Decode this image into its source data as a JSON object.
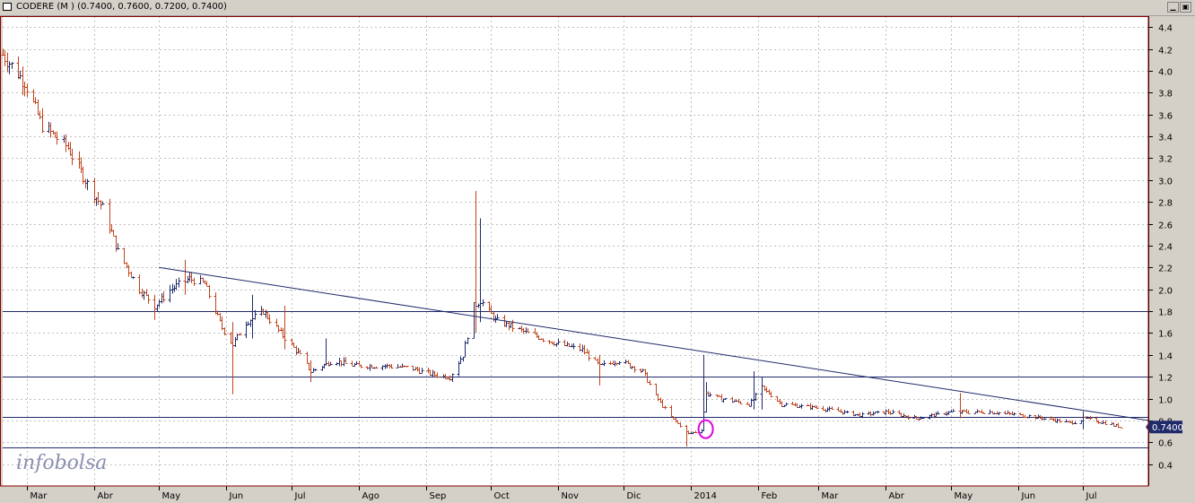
{
  "window": {
    "title": "CODERE (M ) (0.7400, 0.7600, 0.7200, 0.7400)",
    "min_glyph": "▁",
    "max_glyph": "▣"
  },
  "colors": {
    "plot_bg": "#ffffff",
    "grid": "#c0c0c0",
    "up_bar": "#1f2a6b",
    "down_bar": "#c0431c",
    "line": "#1f2a6b",
    "marker": "#e000e0",
    "frame": "#8b0000",
    "price_badge_bg": "#1f2a6b",
    "price_badge_text": "#ffffff"
  },
  "chart_data": {
    "type": "ohlc",
    "title": "CODERE (M ) (0.7400, 0.7600, 0.7200, 0.7400)",
    "ylim": [
      0.2,
      4.5
    ],
    "y_ticks": [
      0.4,
      0.6,
      0.8,
      1.0,
      1.2,
      1.4,
      1.6,
      1.8,
      2.0,
      2.2,
      2.4,
      2.6,
      2.8,
      3.0,
      3.2,
      3.4,
      3.6,
      3.8,
      4.0,
      4.2,
      4.4
    ],
    "y_tick_labels": [
      "0.4",
      "0.6",
      "0.8",
      "1.0",
      "1.2",
      "1.4",
      "1.6",
      "1.8",
      "2.0",
      "2.2",
      "2.4",
      "2.6",
      "2.8",
      "3.0",
      "3.2",
      "3.4",
      "3.6",
      "3.8",
      "4.0",
      "4.2",
      "4.4"
    ],
    "x_start": "2013-02-18",
    "x_end": "2014-07-31",
    "months": [
      {
        "label": "Mar",
        "date": "2013-03-01"
      },
      {
        "label": "Abr",
        "date": "2013-04-01"
      },
      {
        "label": "May",
        "date": "2013-05-01"
      },
      {
        "label": "Jun",
        "date": "2013-06-01"
      },
      {
        "label": "Jul",
        "date": "2013-07-01"
      },
      {
        "label": "Ago",
        "date": "2013-08-01"
      },
      {
        "label": "Sep",
        "date": "2013-09-01"
      },
      {
        "label": "Oct",
        "date": "2013-10-01"
      },
      {
        "label": "Nov",
        "date": "2013-11-01"
      },
      {
        "label": "Dic",
        "date": "2013-12-01"
      },
      {
        "label": "2014",
        "date": "2014-01-01"
      },
      {
        "label": "Feb",
        "date": "2014-02-01"
      },
      {
        "label": "Mar",
        "date": "2014-03-01"
      },
      {
        "label": "Abr",
        "date": "2014-04-01"
      },
      {
        "label": "May",
        "date": "2014-05-01"
      },
      {
        "label": "Jun",
        "date": "2014-06-01"
      },
      {
        "label": "Jul",
        "date": "2014-07-01"
      }
    ],
    "price_anchors": [
      [
        "2013-02-18",
        4.15
      ],
      [
        "2013-02-28",
        3.9
      ],
      [
        "2013-03-08",
        3.5
      ],
      [
        "2013-03-20",
        3.3
      ],
      [
        "2013-03-28",
        3.0
      ],
      [
        "2013-04-05",
        2.75
      ],
      [
        "2013-04-12",
        2.35
      ],
      [
        "2013-04-22",
        2.0
      ],
      [
        "2013-04-29",
        1.85
      ],
      [
        "2013-05-06",
        2.0
      ],
      [
        "2013-05-15",
        2.1
      ],
      [
        "2013-05-22",
        2.05
      ],
      [
        "2013-05-30",
        1.65
      ],
      [
        "2013-06-04",
        1.5
      ],
      [
        "2013-06-10",
        1.7
      ],
      [
        "2013-06-18",
        1.8
      ],
      [
        "2013-06-26",
        1.6
      ],
      [
        "2013-07-05",
        1.4
      ],
      [
        "2013-07-10",
        1.25
      ],
      [
        "2013-07-20",
        1.35
      ],
      [
        "2013-08-01",
        1.3
      ],
      [
        "2013-08-15",
        1.3
      ],
      [
        "2013-08-25",
        1.28
      ],
      [
        "2013-09-05",
        1.22
      ],
      [
        "2013-09-12",
        1.2
      ],
      [
        "2013-09-18",
        1.4
      ],
      [
        "2013-09-23",
        1.85
      ],
      [
        "2013-09-26",
        1.9
      ],
      [
        "2013-10-03",
        1.72
      ],
      [
        "2013-10-18",
        1.6
      ],
      [
        "2013-11-01",
        1.5
      ],
      [
        "2013-11-12",
        1.45
      ],
      [
        "2013-11-20",
        1.3
      ],
      [
        "2013-11-29",
        1.35
      ],
      [
        "2013-12-10",
        1.25
      ],
      [
        "2013-12-15",
        1.05
      ],
      [
        "2013-12-22",
        0.85
      ],
      [
        "2013-12-31",
        0.68
      ],
      [
        "2014-01-06",
        0.72
      ],
      [
        "2014-01-08",
        1.05
      ],
      [
        "2014-01-15",
        1.0
      ],
      [
        "2014-01-28",
        0.95
      ],
      [
        "2014-02-03",
        1.1
      ],
      [
        "2014-02-12",
        0.95
      ],
      [
        "2014-02-28",
        0.92
      ],
      [
        "2014-03-20",
        0.85
      ],
      [
        "2014-04-01",
        0.88
      ],
      [
        "2014-04-15",
        0.82
      ],
      [
        "2014-05-01",
        0.88
      ],
      [
        "2014-05-20",
        0.88
      ],
      [
        "2014-06-10",
        0.83
      ],
      [
        "2014-06-25",
        0.78
      ],
      [
        "2014-07-02",
        0.82
      ],
      [
        "2014-07-15",
        0.76
      ],
      [
        "2014-07-18",
        0.74
      ]
    ],
    "spikes": [
      {
        "date": "2013-04-29",
        "high": 1.95,
        "low": 1.72
      },
      {
        "date": "2013-05-13",
        "high": 2.27,
        "low": 1.95
      },
      {
        "date": "2013-06-04",
        "high": 1.7,
        "low": 1.04
      },
      {
        "date": "2013-06-13",
        "high": 1.95,
        "low": 1.55
      },
      {
        "date": "2013-06-28",
        "high": 1.85,
        "low": 1.45
      },
      {
        "date": "2013-07-10",
        "high": 1.35,
        "low": 1.15
      },
      {
        "date": "2013-07-17",
        "high": 1.55,
        "low": 1.3
      },
      {
        "date": "2013-09-24",
        "high": 2.9,
        "low": 1.6
      },
      {
        "date": "2013-09-26",
        "high": 2.65,
        "low": 1.7
      },
      {
        "date": "2013-09-29",
        "high": 2.1,
        "low": 1.65
      },
      {
        "date": "2013-11-20",
        "high": 1.4,
        "low": 1.12
      },
      {
        "date": "2013-12-30",
        "high": 0.75,
        "low": 0.56
      },
      {
        "date": "2014-01-07",
        "high": 1.4,
        "low": 0.78
      },
      {
        "date": "2014-01-08",
        "high": 1.15,
        "low": 0.9
      },
      {
        "date": "2014-01-30",
        "high": 1.25,
        "low": 0.9
      },
      {
        "date": "2014-02-03",
        "high": 1.2,
        "low": 0.9
      },
      {
        "date": "2014-05-05",
        "high": 1.05,
        "low": 0.82
      },
      {
        "date": "2014-07-01",
        "high": 0.88,
        "low": 0.72
      }
    ],
    "last_price": 0.74,
    "last_price_label": "0.7400",
    "trendline": {
      "start": [
        "2013-05-01",
        2.2
      ],
      "end": [
        "2014-07-31",
        0.8
      ]
    },
    "horizontal_lines": [
      1.8,
      1.2,
      0.83,
      0.55
    ],
    "marker_circle": {
      "date": "2014-01-08",
      "value": 0.72
    },
    "watermark": "infobolsa"
  }
}
